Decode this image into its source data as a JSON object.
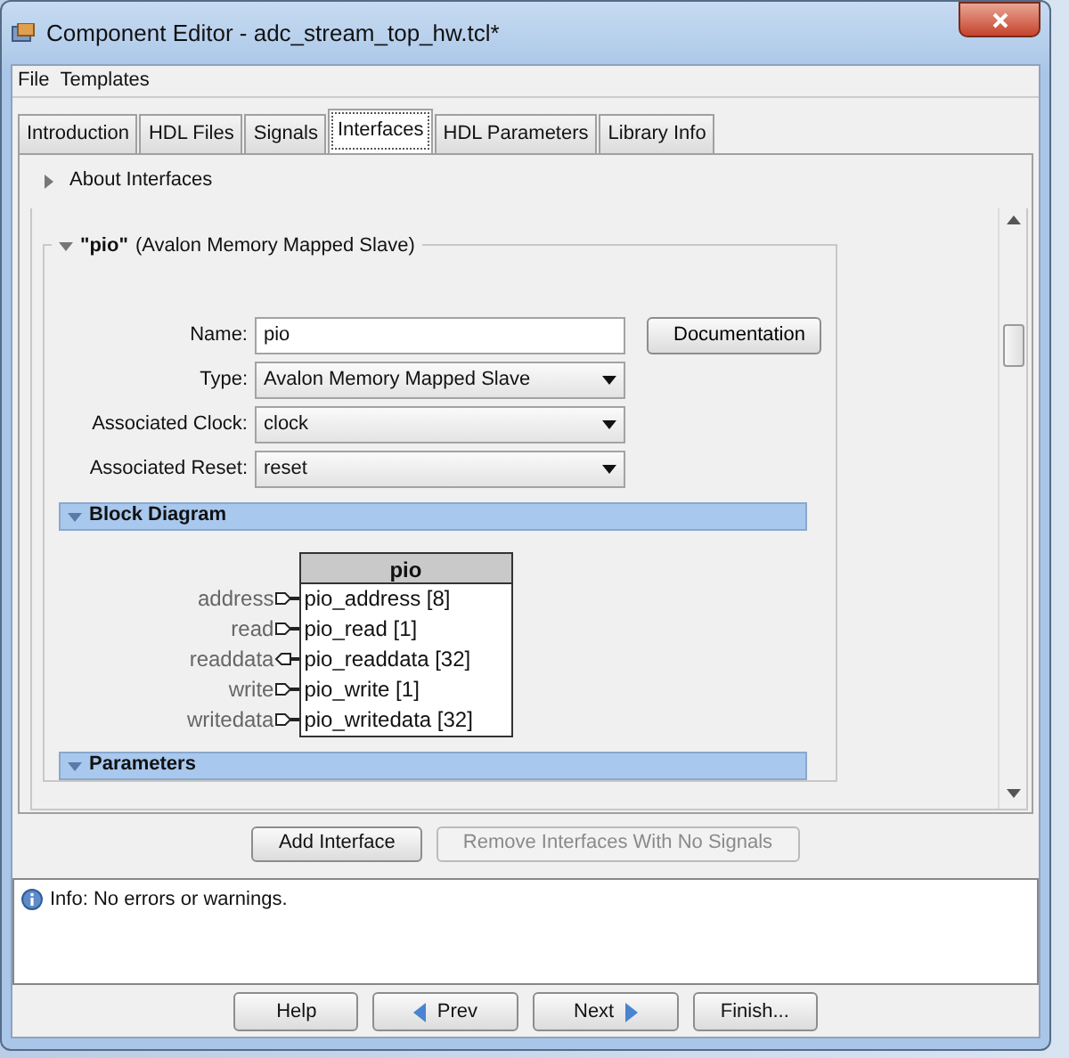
{
  "window": {
    "title": "Component Editor - adc_stream_top_hw.tcl*"
  },
  "menu": [
    "File",
    "Templates"
  ],
  "tabs": [
    {
      "label": "Introduction",
      "selected": false
    },
    {
      "label": "HDL Files",
      "selected": false
    },
    {
      "label": "Signals",
      "selected": false
    },
    {
      "label": "Interfaces",
      "selected": true
    },
    {
      "label": "HDL Parameters",
      "selected": false
    },
    {
      "label": "Library Info",
      "selected": false
    }
  ],
  "about": {
    "label": "About Interfaces",
    "expanded": false
  },
  "interface": {
    "name_quoted": "\"pio\"",
    "type_label": "(Avalon Memory Mapped Slave)",
    "expanded": true,
    "fields": [
      {
        "kind": "text",
        "label": "Name:",
        "value": "pio"
      },
      {
        "kind": "select",
        "label": "Type:",
        "value": "Avalon Memory Mapped Slave"
      },
      {
        "kind": "select",
        "label": "Associated Clock:",
        "value": "clock"
      },
      {
        "kind": "select",
        "label": "Associated Reset:",
        "value": "reset"
      }
    ],
    "documentation_button": "Documentation",
    "sections": [
      {
        "title": "Block Diagram",
        "expanded": true
      },
      {
        "title": "Parameters",
        "expanded": true
      }
    ],
    "block": {
      "title": "pio",
      "ports": [
        {
          "role": "address",
          "signal": "pio_address [8]",
          "kind": "input"
        },
        {
          "role": "read",
          "signal": "pio_read [1]",
          "kind": "input"
        },
        {
          "role": "readdata",
          "signal": "pio_readdata [32]",
          "kind": "output"
        },
        {
          "role": "write",
          "signal": "pio_write [1]",
          "kind": "input"
        },
        {
          "role": "writedata",
          "signal": "pio_writedata [32]",
          "kind": "input"
        }
      ]
    }
  },
  "actions": [
    {
      "label": "Add Interface",
      "disabled": false
    },
    {
      "label": "Remove Interfaces With No Signals",
      "disabled": true
    }
  ],
  "messages": [
    {
      "kind": "info",
      "text": "Info: No errors or warnings."
    }
  ],
  "nav_buttons": [
    {
      "kind": "plain",
      "label": "Help"
    },
    {
      "kind": "prev",
      "label": "Prev"
    },
    {
      "kind": "next",
      "label": "Next"
    },
    {
      "kind": "plain",
      "label": "Finish..."
    }
  ]
}
